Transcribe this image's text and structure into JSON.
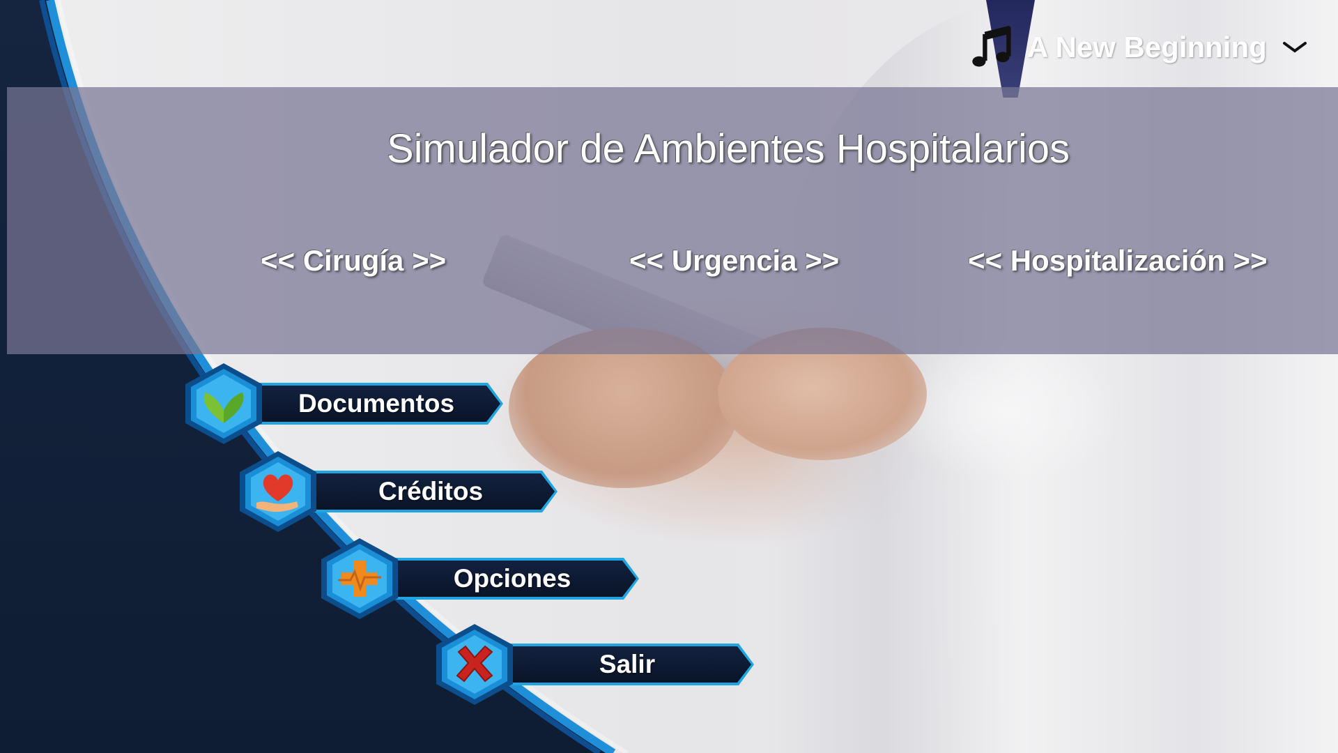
{
  "header": {
    "title": "Simulador de Ambientes Hospitalarios"
  },
  "modes": [
    {
      "label": "<< Cirugía >>"
    },
    {
      "label": "<< Urgencia >>"
    },
    {
      "label": "<< Hospitalización >>"
    }
  ],
  "music": {
    "icon": "music-note-icon",
    "track": "A New Beginning",
    "dropdown_icon": "chevron-down-icon"
  },
  "menu": [
    {
      "label": "Documentos",
      "icon": "leaf-heart-icon"
    },
    {
      "label": "Créditos",
      "icon": "heart-hand-icon"
    },
    {
      "label": "Opciones",
      "icon": "medical-cross-icon"
    },
    {
      "label": "Salir",
      "icon": "red-x-icon"
    }
  ],
  "colors": {
    "banner": "#797694",
    "navy": "#0d1a33",
    "accent_blue": "#1fa6e0"
  }
}
